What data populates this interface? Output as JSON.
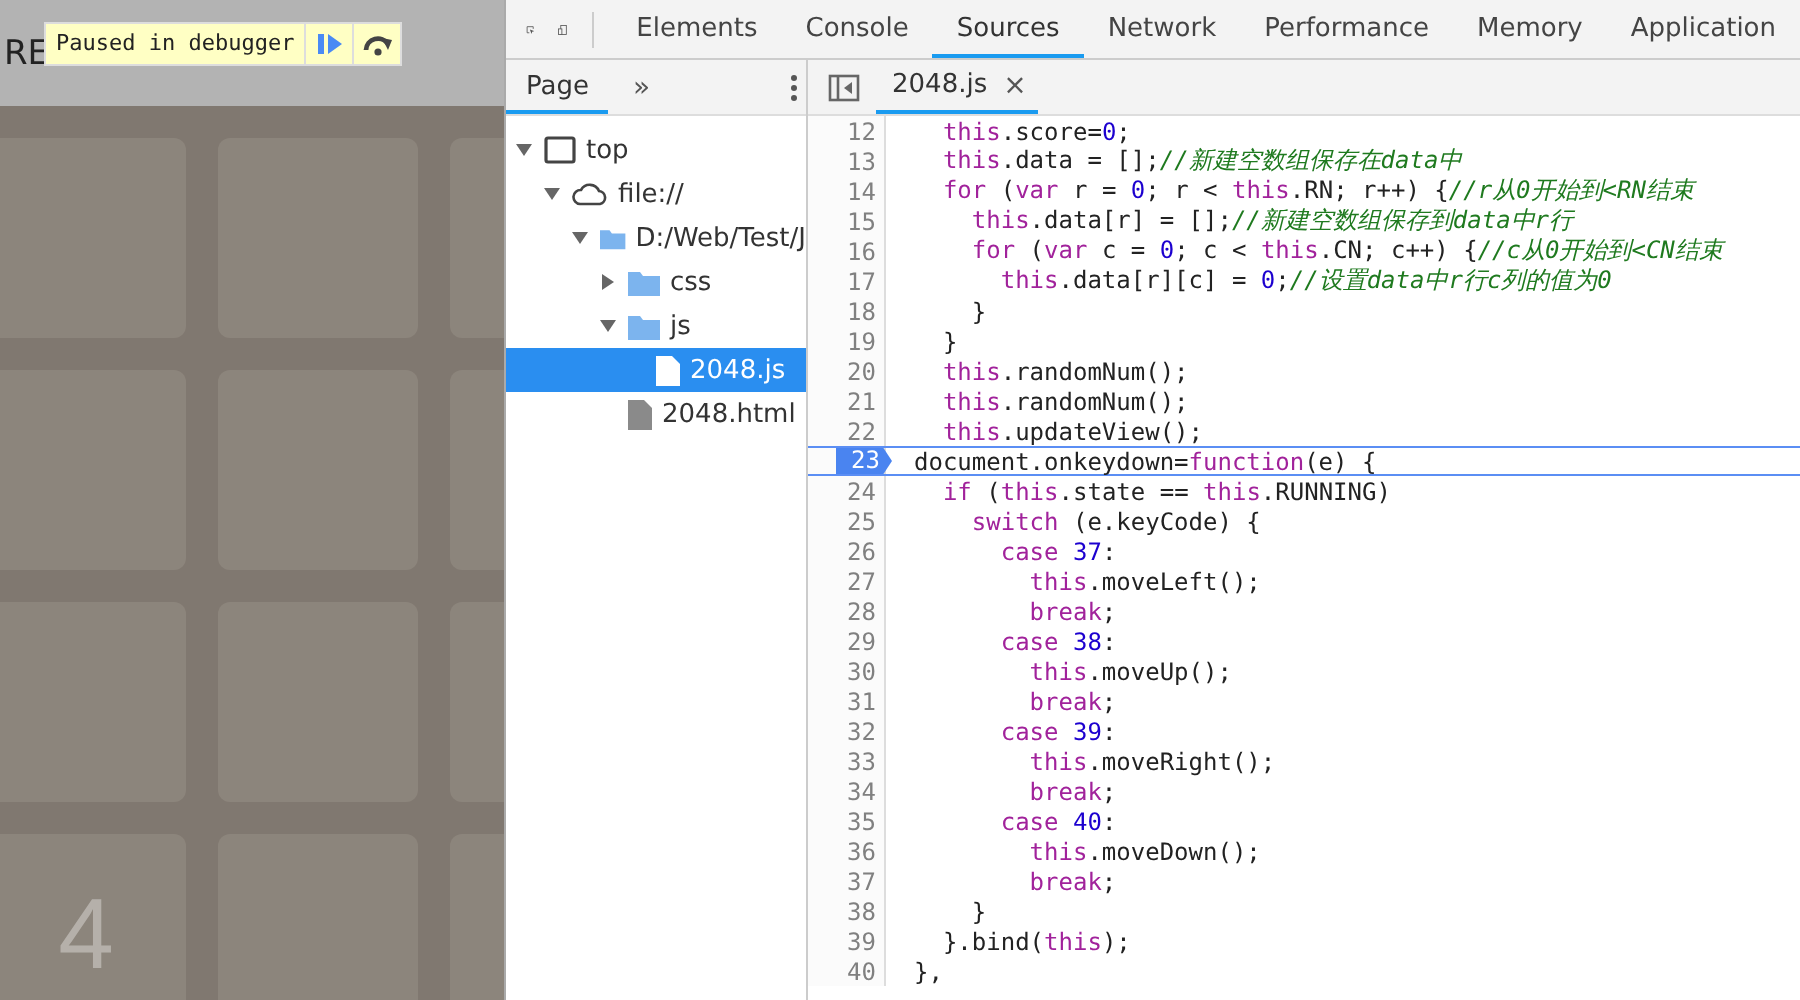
{
  "game": {
    "score_label": "RE",
    "board": [
      {
        "tiles": [
          {
            "kind": "empty"
          },
          {
            "kind": "empty"
          },
          {
            "kind": "empty"
          }
        ]
      },
      {
        "tiles": [
          {
            "kind": "empty"
          },
          {
            "kind": "empty"
          },
          {
            "kind": "empty"
          }
        ]
      },
      {
        "tiles": [
          {
            "kind": "empty"
          },
          {
            "kind": "empty"
          },
          {
            "kind": "empty"
          }
        ]
      },
      {
        "tiles": [
          {
            "kind": "number",
            "number": "4"
          },
          {
            "kind": "empty"
          },
          {
            "kind": "empty"
          }
        ]
      }
    ]
  },
  "debugger_banner": {
    "text": "Paused in debugger"
  },
  "devtools": {
    "tabs": [
      {
        "label": "Elements",
        "selected": false
      },
      {
        "label": "Console",
        "selected": false
      },
      {
        "label": "Sources",
        "selected": true
      },
      {
        "label": "Network",
        "selected": false
      },
      {
        "label": "Performance",
        "selected": false
      },
      {
        "label": "Memory",
        "selected": false
      },
      {
        "label": "Application",
        "selected": false
      }
    ],
    "navigator": {
      "tab": "Page",
      "more": "»",
      "tree": [
        {
          "label": "top",
          "kind": "window",
          "expanded": true,
          "selected": false,
          "children": [
            {
              "label": "file://",
              "kind": "cloud",
              "expanded": true,
              "selected": false,
              "children": [
                {
                  "label": "D:/Web/Test/J",
                  "kind": "folder",
                  "expanded": true,
                  "selected": false,
                  "children": [
                    {
                      "label": "css",
                      "kind": "folder",
                      "expanded": false,
                      "selected": false
                    },
                    {
                      "label": "js",
                      "kind": "folder",
                      "expanded": true,
                      "selected": false,
                      "children": [
                        {
                          "label": "2048.js",
                          "kind": "file",
                          "selected": true
                        }
                      ]
                    },
                    {
                      "label": "2048.html",
                      "kind": "page",
                      "selected": false
                    }
                  ]
                }
              ]
            }
          ]
        }
      ]
    },
    "editor": {
      "file_tab": "2048.js",
      "close": "×",
      "lines": [
        {
          "number": "12",
          "breakpoint": false,
          "tokens": [
            {
              "text": "  this",
              "kind": "keyword"
            },
            {
              "text": ".score=",
              "kind": "plain"
            },
            {
              "text": "0",
              "kind": "number"
            },
            {
              "text": ";",
              "kind": "plain"
            }
          ]
        },
        {
          "number": "13",
          "breakpoint": false,
          "tokens": [
            {
              "text": "  this",
              "kind": "keyword"
            },
            {
              "text": ".data = [];",
              "kind": "plain"
            },
            {
              "text": "//新建空数组保存在data中",
              "kind": "comment"
            }
          ]
        },
        {
          "number": "14",
          "breakpoint": false,
          "tokens": [
            {
              "text": "  for",
              "kind": "keyword"
            },
            {
              "text": " (",
              "kind": "plain"
            },
            {
              "text": "var",
              "kind": "keyword"
            },
            {
              "text": " r = ",
              "kind": "plain"
            },
            {
              "text": "0",
              "kind": "number"
            },
            {
              "text": "; r < ",
              "kind": "plain"
            },
            {
              "text": "this",
              "kind": "keyword"
            },
            {
              "text": ".RN; r++) {",
              "kind": "plain"
            },
            {
              "text": "//r从0开始到<RN结束",
              "kind": "comment"
            }
          ]
        },
        {
          "number": "15",
          "breakpoint": false,
          "tokens": [
            {
              "text": "    this",
              "kind": "keyword"
            },
            {
              "text": ".data[r] = [];",
              "kind": "plain"
            },
            {
              "text": "//新建空数组保存到data中r行",
              "kind": "comment"
            }
          ]
        },
        {
          "number": "16",
          "breakpoint": false,
          "tokens": [
            {
              "text": "    for",
              "kind": "keyword"
            },
            {
              "text": " (",
              "kind": "plain"
            },
            {
              "text": "var",
              "kind": "keyword"
            },
            {
              "text": " c = ",
              "kind": "plain"
            },
            {
              "text": "0",
              "kind": "number"
            },
            {
              "text": "; c < ",
              "kind": "plain"
            },
            {
              "text": "this",
              "kind": "keyword"
            },
            {
              "text": ".CN; c++) {",
              "kind": "plain"
            },
            {
              "text": "//c从0开始到<CN结束",
              "kind": "comment"
            }
          ]
        },
        {
          "number": "17",
          "breakpoint": false,
          "tokens": [
            {
              "text": "      this",
              "kind": "keyword"
            },
            {
              "text": ".data[r][c] = ",
              "kind": "plain"
            },
            {
              "text": "0",
              "kind": "number"
            },
            {
              "text": ";",
              "kind": "plain"
            },
            {
              "text": "//设置data中r行c列的值为0",
              "kind": "comment"
            }
          ]
        },
        {
          "number": "18",
          "breakpoint": false,
          "tokens": [
            {
              "text": "    }",
              "kind": "plain"
            }
          ]
        },
        {
          "number": "19",
          "breakpoint": false,
          "tokens": [
            {
              "text": "  }",
              "kind": "plain"
            }
          ]
        },
        {
          "number": "20",
          "breakpoint": false,
          "tokens": [
            {
              "text": "  this",
              "kind": "keyword"
            },
            {
              "text": ".randomNum();",
              "kind": "plain"
            }
          ]
        },
        {
          "number": "21",
          "breakpoint": false,
          "tokens": [
            {
              "text": "  this",
              "kind": "keyword"
            },
            {
              "text": ".randomNum();",
              "kind": "plain"
            }
          ]
        },
        {
          "number": "22",
          "breakpoint": false,
          "tokens": [
            {
              "text": "  this",
              "kind": "keyword"
            },
            {
              "text": ".updateView();",
              "kind": "plain"
            }
          ]
        },
        {
          "number": "23",
          "breakpoint": true,
          "tokens": [
            {
              "text": "document.onkeydown=",
              "kind": "plain"
            },
            {
              "text": "function",
              "kind": "keyword"
            },
            {
              "text": "(e) {",
              "kind": "plain"
            }
          ]
        },
        {
          "number": "24",
          "breakpoint": false,
          "tokens": [
            {
              "text": "  if",
              "kind": "keyword"
            },
            {
              "text": " (",
              "kind": "plain"
            },
            {
              "text": "this",
              "kind": "keyword"
            },
            {
              "text": ".state == ",
              "kind": "plain"
            },
            {
              "text": "this",
              "kind": "keyword"
            },
            {
              "text": ".RUNNING)",
              "kind": "plain"
            }
          ]
        },
        {
          "number": "25",
          "breakpoint": false,
          "tokens": [
            {
              "text": "    switch",
              "kind": "keyword"
            },
            {
              "text": " (e.keyCode) {",
              "kind": "plain"
            }
          ]
        },
        {
          "number": "26",
          "breakpoint": false,
          "tokens": [
            {
              "text": "      case ",
              "kind": "keyword"
            },
            {
              "text": "37",
              "kind": "number"
            },
            {
              "text": ":",
              "kind": "plain"
            }
          ]
        },
        {
          "number": "27",
          "breakpoint": false,
          "tokens": [
            {
              "text": "        this",
              "kind": "keyword"
            },
            {
              "text": ".moveLeft();",
              "kind": "plain"
            }
          ]
        },
        {
          "number": "28",
          "breakpoint": false,
          "tokens": [
            {
              "text": "        break",
              "kind": "keyword"
            },
            {
              "text": ";",
              "kind": "plain"
            }
          ]
        },
        {
          "number": "29",
          "breakpoint": false,
          "tokens": [
            {
              "text": "      case ",
              "kind": "keyword"
            },
            {
              "text": "38",
              "kind": "number"
            },
            {
              "text": ":",
              "kind": "plain"
            }
          ]
        },
        {
          "number": "30",
          "breakpoint": false,
          "tokens": [
            {
              "text": "        this",
              "kind": "keyword"
            },
            {
              "text": ".moveUp();",
              "kind": "plain"
            }
          ]
        },
        {
          "number": "31",
          "breakpoint": false,
          "tokens": [
            {
              "text": "        break",
              "kind": "keyword"
            },
            {
              "text": ";",
              "kind": "plain"
            }
          ]
        },
        {
          "number": "32",
          "breakpoint": false,
          "tokens": [
            {
              "text": "      case ",
              "kind": "keyword"
            },
            {
              "text": "39",
              "kind": "number"
            },
            {
              "text": ":",
              "kind": "plain"
            }
          ]
        },
        {
          "number": "33",
          "breakpoint": false,
          "tokens": [
            {
              "text": "        this",
              "kind": "keyword"
            },
            {
              "text": ".moveRight();",
              "kind": "plain"
            }
          ]
        },
        {
          "number": "34",
          "breakpoint": false,
          "tokens": [
            {
              "text": "        break",
              "kind": "keyword"
            },
            {
              "text": ";",
              "kind": "plain"
            }
          ]
        },
        {
          "number": "35",
          "breakpoint": false,
          "tokens": [
            {
              "text": "      case ",
              "kind": "keyword"
            },
            {
              "text": "40",
              "kind": "number"
            },
            {
              "text": ":",
              "kind": "plain"
            }
          ]
        },
        {
          "number": "36",
          "breakpoint": false,
          "tokens": [
            {
              "text": "        this",
              "kind": "keyword"
            },
            {
              "text": ".moveDown();",
              "kind": "plain"
            }
          ]
        },
        {
          "number": "37",
          "breakpoint": false,
          "tokens": [
            {
              "text": "        break",
              "kind": "keyword"
            },
            {
              "text": ";",
              "kind": "plain"
            }
          ]
        },
        {
          "number": "38",
          "breakpoint": false,
          "tokens": [
            {
              "text": "    }",
              "kind": "plain"
            }
          ]
        },
        {
          "number": "39",
          "breakpoint": false,
          "tokens": [
            {
              "text": "  }.bind(",
              "kind": "plain"
            },
            {
              "text": "this",
              "kind": "keyword"
            },
            {
              "text": ");",
              "kind": "plain"
            }
          ]
        },
        {
          "number": "40",
          "breakpoint": false,
          "tokens": [
            {
              "text": "},",
              "kind": "plain"
            }
          ]
        }
      ]
    }
  }
}
